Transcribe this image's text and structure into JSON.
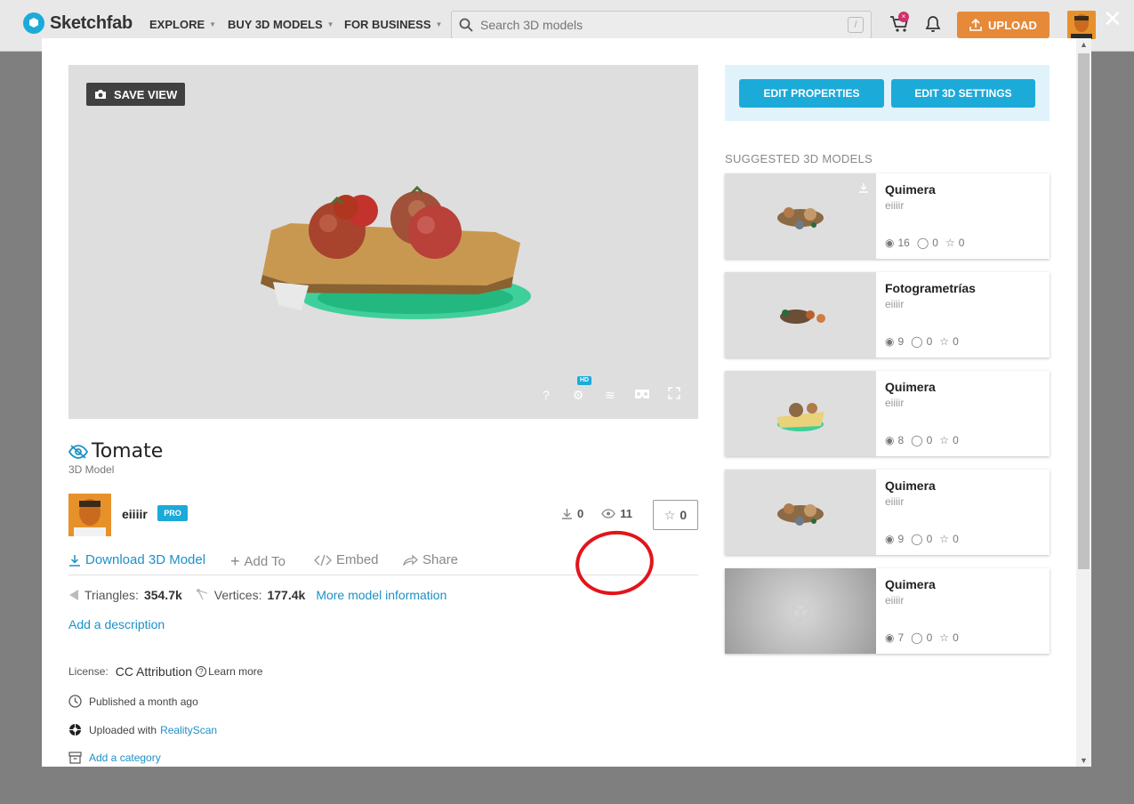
{
  "topbar": {
    "brand": "Sketchfab",
    "nav": [
      "EXPLORE",
      "BUY 3D MODELS",
      "FOR BUSINESS"
    ],
    "search_placeholder": "Search 3D models",
    "search_shortcut": "/",
    "cart_badge": "×",
    "upload_label": "UPLOAD",
    "close": "✕"
  },
  "viewer": {
    "save_view_label": "SAVE VIEW",
    "tools": [
      "help-icon",
      "settings-icon",
      "layers-icon",
      "vr-icon",
      "fullscreen-icon"
    ],
    "hd_badge": "HD"
  },
  "model": {
    "title": "Tomate",
    "type": "3D Model",
    "author": "eiiiir",
    "author_badge": "PRO",
    "downloads": "0",
    "views": "11",
    "likes": "0"
  },
  "actions": {
    "download": "Download 3D Model",
    "add_to": "Add To",
    "embed": "Embed",
    "share": "Share"
  },
  "specs": {
    "triangles_label": "Triangles:",
    "triangles": "354.7k",
    "vertices_label": "Vertices:",
    "vertices": "177.4k",
    "more": "More model information"
  },
  "add_description": "Add a description",
  "meta": {
    "license_label": "License:",
    "license_value": "CC Attribution",
    "learn_more": "Learn more",
    "published": "Published a month ago",
    "uploaded_prefix": "Uploaded with",
    "uploaded_app": "RealityScan",
    "add_category": "Add a category"
  },
  "edit": {
    "properties": "EDIT PROPERTIES",
    "settings": "EDIT 3D SETTINGS"
  },
  "suggested": {
    "heading": "SUGGESTED 3D MODELS",
    "items": [
      {
        "title": "Quimera",
        "author": "eiiiir",
        "views": "16",
        "comments": "0",
        "likes": "0"
      },
      {
        "title": "Fotogrametrías",
        "author": "eiiiir",
        "views": "9",
        "comments": "0",
        "likes": "0"
      },
      {
        "title": "Quimera",
        "author": "eiiiir",
        "views": "8",
        "comments": "0",
        "likes": "0"
      },
      {
        "title": "Quimera",
        "author": "eiiiir",
        "views": "9",
        "comments": "0",
        "likes": "0"
      },
      {
        "title": "Quimera",
        "author": "eiiiir",
        "views": "7",
        "comments": "0",
        "likes": "0"
      }
    ]
  },
  "colors": {
    "brand_blue": "#1caad9",
    "upload_orange": "#e68a3a",
    "annotation_red": "#e2141b"
  }
}
